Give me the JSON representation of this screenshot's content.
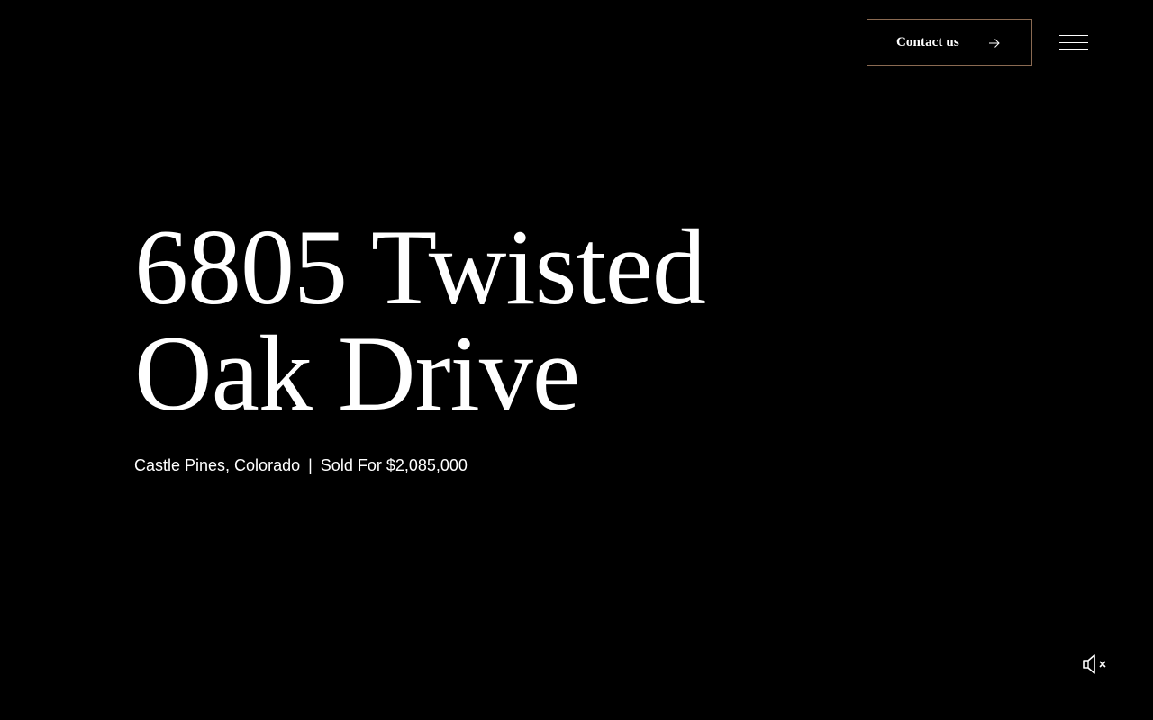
{
  "header": {
    "contact_label": "Contact us",
    "contact_icon": "arrow-right-icon",
    "menu_icon": "hamburger-menu-icon"
  },
  "hero": {
    "title_line1": "6805 Twisted",
    "title_line2": "Oak Drive",
    "location": "Castle Pines, Colorado",
    "separator": "|",
    "status": "Sold For $2,085,000"
  },
  "media": {
    "mute_icon": "speaker-muted-icon"
  },
  "colors": {
    "background": "#000000",
    "text": "#ffffff",
    "button_border": "#8a6a52"
  }
}
